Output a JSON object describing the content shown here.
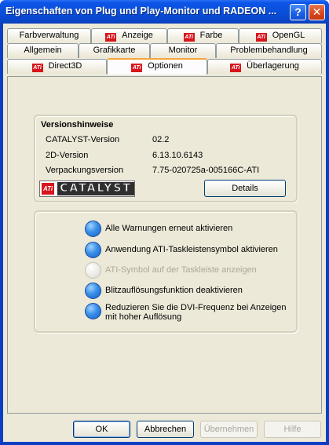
{
  "window": {
    "title": "Eigenschaften von Plug und Play-Monitor und RADEON ...",
    "help_glyph": "?",
    "close_glyph": "✕"
  },
  "tabs": {
    "row1": [
      {
        "label": "Farbverwaltung",
        "ati": false
      },
      {
        "label": "Anzeige",
        "ati": true
      },
      {
        "label": "Farbe",
        "ati": true
      },
      {
        "label": "OpenGL",
        "ati": true
      }
    ],
    "row2": [
      {
        "label": "Allgemein",
        "ati": false
      },
      {
        "label": "Grafikkarte",
        "ati": false
      },
      {
        "label": "Monitor",
        "ati": false
      },
      {
        "label": "Problembehandlung",
        "ati": false
      }
    ],
    "row3": [
      {
        "label": "Direct3D",
        "ati": true
      },
      {
        "label": "Optionen",
        "ati": true,
        "active": true
      },
      {
        "label": "Überlagerung",
        "ati": true
      }
    ],
    "ati_logo_text": "ATi"
  },
  "version_group": {
    "title": "Versionshinweise",
    "rows": [
      {
        "label": "CATALYST-Version",
        "value": "02.2"
      },
      {
        "label": "2D-Version",
        "value": "6.13.10.6143"
      },
      {
        "label": "Verpackungsversion",
        "value": "7.75-020725a-005166C-ATI"
      }
    ],
    "logo_badge": "ATi",
    "logo_word": "CATALYST",
    "details_button": "Details"
  },
  "options_group": {
    "items": [
      {
        "label": "Alle Warnungen erneut aktivieren",
        "enabled": true
      },
      {
        "label": "Anwendung ATI-Taskleistensymbol aktivieren",
        "enabled": true
      },
      {
        "label": "ATI-Symbol auf der Taskleiste anzeigen",
        "enabled": false
      },
      {
        "label": "Blitzauflösungsfunktion deaktivieren",
        "enabled": true
      },
      {
        "label": "Reduzieren Sie die DVI-Frequenz bei Anzeigen mit hoher Auflösung",
        "enabled": true
      }
    ]
  },
  "footer": {
    "ok": "OK",
    "cancel": "Abbrechen",
    "apply": "Übernehmen",
    "help": "Hilfe"
  },
  "colors": {
    "titlebar": "#0a4fd9",
    "active_tab_accent": "#f7a43a",
    "ati_red": "#d8141c",
    "orb_blue": "#3a8fe8"
  }
}
